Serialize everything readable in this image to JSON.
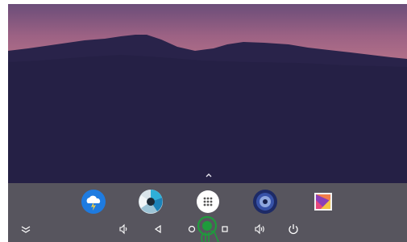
{
  "icons": {
    "weather": "weather-cloud-lightning-icon",
    "browser": "browser-aperture-icon",
    "all_apps": "all-apps-grid-icon",
    "music": "music-speaker-icon",
    "gallery": "gallery-photo-icon",
    "collapse": "collapse-chevron-icon",
    "volume_down": "volume-down-icon",
    "back": "back-triangle-icon",
    "home": "home-circle-icon",
    "recents": "recents-square-icon",
    "volume_up": "volume-up-icon",
    "power": "power-icon",
    "touch": "touch-indicator-icon",
    "expand": "chevron-up-icon"
  },
  "colors": {
    "dock": "#57555e",
    "weather_blue": "#1e7be0",
    "touch_indicator": "#1f9b3c"
  }
}
